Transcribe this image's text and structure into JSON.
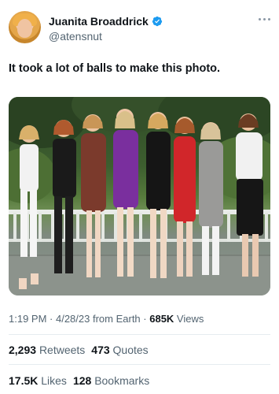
{
  "author": {
    "display_name": "Juanita Broaddrick",
    "handle": "@atensnut",
    "verified_icon": "verified-badge-icon",
    "verified_color": "#1d9bf0"
  },
  "tweet": {
    "text": "It took a lot of balls to make this photo."
  },
  "meta": {
    "time": "1:19 PM",
    "sep1": " · ",
    "date": "4/28/23",
    "from_prefix": " from ",
    "location": "Earth",
    "sep2": " · ",
    "views_count": "685K",
    "views_label": " Views"
  },
  "stats": {
    "retweets_count": "2,293",
    "retweets_label": "Retweets",
    "quotes_count": "473",
    "quotes_label": "Quotes",
    "likes_count": "17.5K",
    "likes_label": "Likes",
    "bookmarks_count": "128",
    "bookmarks_label": "Bookmarks"
  }
}
